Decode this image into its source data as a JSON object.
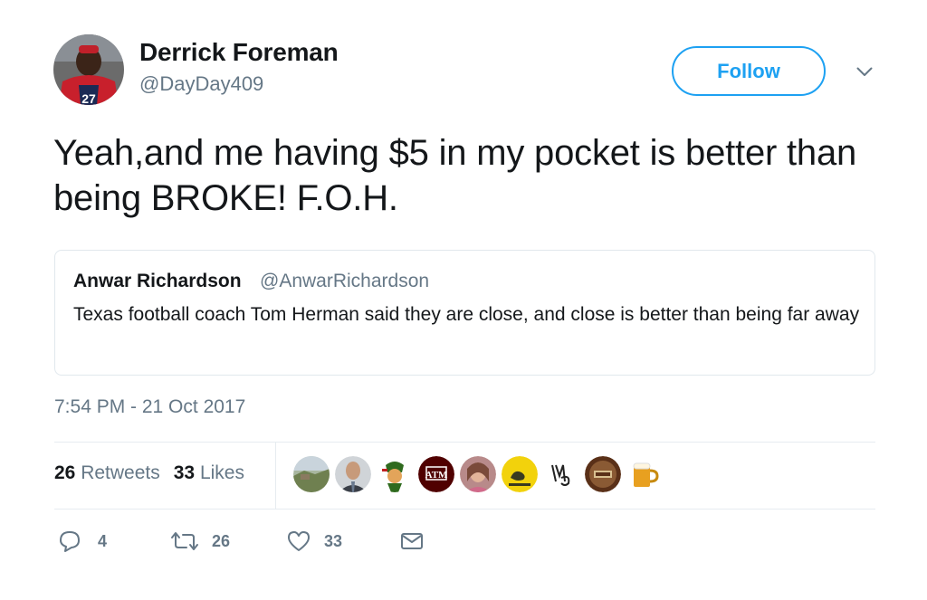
{
  "author": {
    "name": "Derrick Foreman",
    "handle": "@DayDay409"
  },
  "follow_label": "Follow",
  "tweet_text": "Yeah,and me having $5 in my pocket is better than being BROKE! F.O.H.",
  "quoted": {
    "name": "Anwar Richardson",
    "handle": "@AnwarRichardson",
    "text": "Texas football coach Tom Herman said they are close, and close is better than being far away"
  },
  "timestamp": "7:54 PM - 21 Oct 2017",
  "stats": {
    "retweets_count": "26",
    "retweets_label": "Retweets",
    "likes_count": "33",
    "likes_label": "Likes"
  },
  "likers": [
    {
      "icon": "landscape-avatar",
      "color": "#7a8a6a"
    },
    {
      "icon": "man-suit-avatar",
      "color": "#5a5a5a"
    },
    {
      "icon": "cartoon-avatar",
      "color": "#4a7a2a"
    },
    {
      "icon": "atm-logo-avatar",
      "color": "#500000"
    },
    {
      "icon": "woman-avatar",
      "color": "#b08080"
    },
    {
      "icon": "gadsden-flag-avatar",
      "color": "#f0d000"
    },
    {
      "icon": "monogram-avatar",
      "color": "#ffffff"
    },
    {
      "icon": "outta-texas-avatar",
      "color": "#6a3a1a"
    },
    {
      "icon": "beer-mug-avatar",
      "color": "#e8a020"
    }
  ],
  "actions": {
    "replies": "4",
    "retweets": "26",
    "likes": "33"
  },
  "colors": {
    "accent": "#1da1f2",
    "secondary_text": "#657786",
    "primary_text": "#14171a",
    "divider": "#e6ecf0"
  }
}
